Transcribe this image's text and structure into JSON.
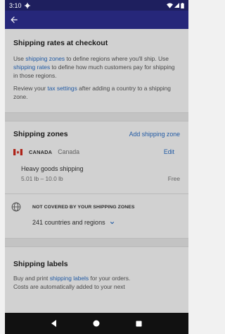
{
  "status_bar": {
    "time": "3:10",
    "icons": [
      "settings-gear-icon",
      "wifi-icon",
      "cell-signal-icon",
      "battery-icon"
    ]
  },
  "app_bar": {
    "back_icon": "arrow-back-icon"
  },
  "rates": {
    "title": "Shipping rates at checkout",
    "p1_a": "Use ",
    "p1_link1": "shipping zones",
    "p1_b": " to define regions where you'll ship. Use ",
    "p1_link2": "shipping rates",
    "p1_c": " to define how much customers pay for shipping in those regions.",
    "p2_a": "Review your ",
    "p2_link": "tax settings",
    "p2_b": " after adding a country to a shipping zone."
  },
  "zones": {
    "title": "Shipping zones",
    "add_label": "Add shipping zone",
    "country": {
      "code": "CANADA",
      "name": "Canada",
      "edit_label": "Edit",
      "flag_icon": "canada-flag-icon",
      "rate_name": "Heavy goods shipping",
      "rate_range": "5.01 lb – 10.0 lb",
      "rate_price": "Free"
    },
    "not_covered": {
      "label": "NOT COVERED BY YOUR SHIPPING ZONES",
      "icon": "globe-icon",
      "countries": "241 countries and regions",
      "chevron_icon": "chevron-down-icon"
    }
  },
  "labels": {
    "title": "Shipping labels",
    "text_a": "Buy and print ",
    "text_link": "shipping labels",
    "text_b": " for your orders.",
    "text_c": "Costs are automatically added to your next"
  },
  "nav_bar": {
    "icons": [
      "back-triangle-icon",
      "home-circle-icon",
      "recents-square-icon"
    ]
  },
  "colors": {
    "status_bar": "#1e1f5e",
    "app_bar": "#26277a",
    "link": "#2a6fc9",
    "canada_red": "#d52b1e"
  }
}
